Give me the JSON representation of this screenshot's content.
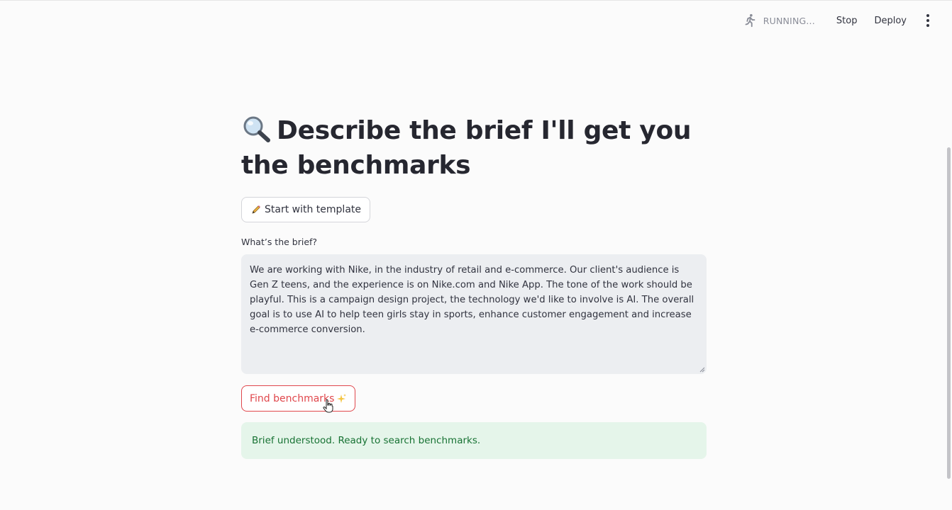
{
  "toolbar": {
    "status_text": "RUNNING...",
    "status_icon": "running-person-icon",
    "stop_label": "Stop",
    "deploy_label": "Deploy",
    "menu_icon": "kebab-menu-icon"
  },
  "page": {
    "title_icon": "magnifying-glass-icon",
    "title": "Describe the brief I'll get you the benchmarks"
  },
  "template_button": {
    "icon": "pencil-icon",
    "label": "Start with template"
  },
  "brief_field": {
    "label": "What’s the brief?",
    "value": "We are working with Nike, in the industry of retail and e-commerce. Our client's audience is Gen Z teens, and the experience is on Nike.com and Nike App. The tone of the work should be playful. This is a campaign design project, the technology we'd like to involve is AI. The overall goal is to use AI to help teen girls stay in sports, enhance customer engagement and increase e-commerce conversion."
  },
  "find_button": {
    "label": "Find benchmarks",
    "icon": "sparkles-icon",
    "color": "#e0474c"
  },
  "status_alert": {
    "message": "Brief understood. Ready to search benchmarks.",
    "background": "#e5f5ea",
    "text_color": "#177233"
  }
}
